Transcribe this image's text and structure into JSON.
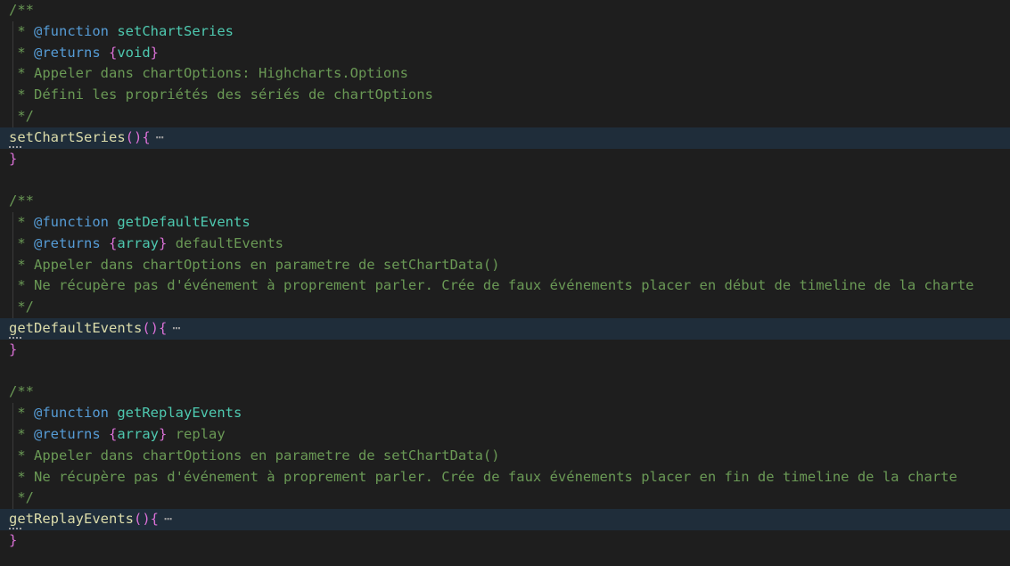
{
  "blocks": [
    {
      "doc_open": "/**",
      "function_tag": "@function",
      "function_name": "setChartSeries",
      "returns_tag": "@returns",
      "returns_type": "void",
      "returns_name": "",
      "desc1": "Appeler dans chartOptions: Highcharts.Options",
      "desc2": "Défini les propriétés des sériés de chartOptions",
      "doc_close": "*/",
      "signature": "setChartSeries",
      "ellipsis": "⋯",
      "close_brace": "}"
    },
    {
      "doc_open": "/**",
      "function_tag": "@function",
      "function_name": "getDefaultEvents",
      "returns_tag": "@returns",
      "returns_type": "array",
      "returns_name": "defaultEvents",
      "desc1": "Appeler dans chartOptions en parametre de setChartData()",
      "desc2": "Ne récupère pas d'événement à proprement parler. Crée de faux événements placer en début de timeline de la charte",
      "doc_close": "*/",
      "signature": "getDefaultEvents",
      "ellipsis": "⋯",
      "close_brace": "}"
    },
    {
      "doc_open": "/**",
      "function_tag": "@function",
      "function_name": "getReplayEvents",
      "returns_tag": "@returns",
      "returns_type": "array",
      "returns_name": "replay",
      "desc1": "Appeler dans chartOptions en parametre de setChartData()",
      "desc2": "Ne récupère pas d'événement à proprement parler. Crée de faux événements placer en fin de timeline de la charte",
      "doc_close": "*/",
      "signature": "getReplayEvents",
      "ellipsis": "⋯",
      "close_brace": "}"
    }
  ],
  "colors": {
    "background": "#1e1e1e",
    "comment": "#6a9955",
    "tag": "#569cd6",
    "type": "#4ec9b0",
    "method": "#dcdcaa",
    "bracket": "#da70d6",
    "folded_line": "#1f2d3a"
  }
}
